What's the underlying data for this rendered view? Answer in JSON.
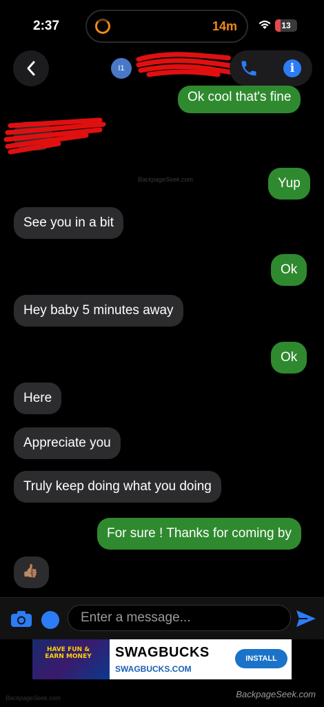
{
  "status_bar": {
    "time": "2:37",
    "activity_time": "14m",
    "battery_level": "13",
    "accent_color": "#f08a1c"
  },
  "header": {
    "avatar_text": "I1",
    "contact_name": "",
    "icons": [
      "chevron-left-icon",
      "phone-icon",
      "info-icon"
    ]
  },
  "messages": [
    {
      "side": "sent",
      "text": "Ok cool that's fine"
    },
    {
      "side": "recv",
      "text": ""
    },
    {
      "side": "sent",
      "text": "Yup"
    },
    {
      "side": "recv",
      "text": "See you in a bit"
    },
    {
      "side": "sent",
      "text": "Ok"
    },
    {
      "side": "recv",
      "text": "Hey baby 5 minutes away"
    },
    {
      "side": "sent",
      "text": "Ok"
    },
    {
      "side": "recv",
      "text": "Here"
    },
    {
      "side": "recv",
      "text": "Appreciate you"
    },
    {
      "side": "recv",
      "text": "Truly keep doing what you doing"
    },
    {
      "side": "sent",
      "text": "For sure ! Thanks for coming by"
    },
    {
      "side": "recv",
      "text": "👍🏽"
    }
  ],
  "watermark_mid": "BackpageSeek.com",
  "composer": {
    "placeholder": "Enter a message...",
    "icons": [
      "camera-icon",
      "emoji-icon",
      "send-icon"
    ]
  },
  "ad": {
    "image_text": "HAVE FUN & EARN MONEY",
    "title": "SWAGBUCKS",
    "url": "SWAGBUCKS.COM",
    "install_label": "INSTALL"
  },
  "footer": {
    "watermark_left": "BackpageSeek.com",
    "watermark_right": "BackpageSeek.com"
  },
  "colors": {
    "sent_bubble": "#2f8a2f",
    "received_bubble": "#2c2c2e",
    "accent_blue": "#2c7cf6",
    "background": "#000000"
  }
}
